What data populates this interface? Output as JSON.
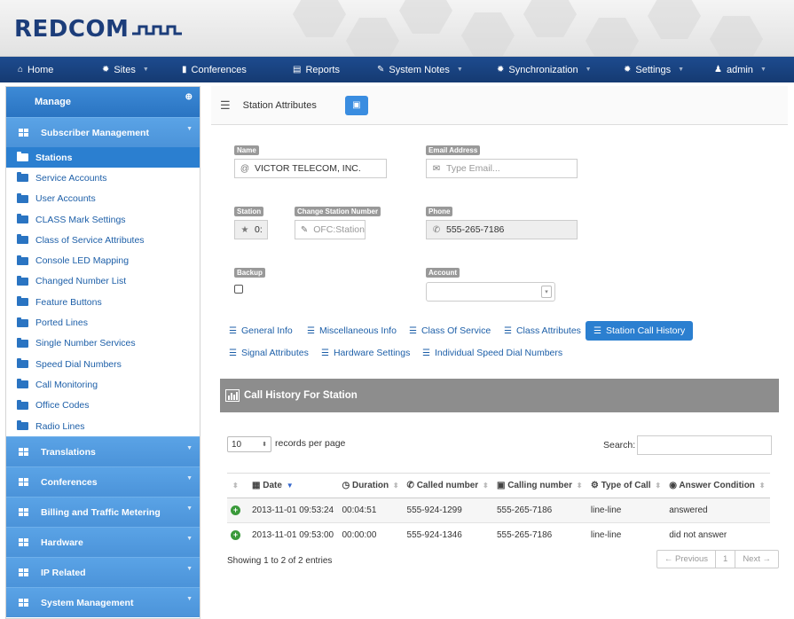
{
  "brand": {
    "logo_text": "REDCOM"
  },
  "nav": {
    "home": "Home",
    "sites": "Sites",
    "conferences": "Conferences",
    "reports": "Reports",
    "system_notes": "System Notes",
    "synchronization": "Synchronization",
    "settings": "Settings",
    "admin": "admin"
  },
  "sidebar": {
    "manage": "Manage",
    "subscriber_management": "Subscriber Management",
    "items": [
      "Stations",
      "Service Accounts",
      "User Accounts",
      "CLASS Mark Settings",
      "Class of Service Attributes",
      "Console LED Mapping",
      "Changed Number List",
      "Feature Buttons",
      "Ported Lines",
      "Single Number Services",
      "Speed Dial Numbers",
      "Call Monitoring",
      "Office Codes",
      "Radio Lines"
    ],
    "sections": [
      "Translations",
      "Conferences",
      "Billing and Traffic Metering",
      "Hardware",
      "IP Related",
      "System Management"
    ]
  },
  "main": {
    "title": "Station Attributes",
    "form": {
      "name_label": "Name",
      "name_value": "VICTOR TELECOM, INC.",
      "email_label": "Email Address",
      "email_placeholder": "Type Email...",
      "station_label": "Station",
      "station_value": "0:",
      "change_station_label": "Change Station Number",
      "change_station_placeholder": "OFC:Station",
      "phone_label": "Phone",
      "phone_value": "555-265-7186",
      "backup_label": "Backup",
      "account_label": "Account"
    },
    "tabs": [
      "General Info",
      "Miscellaneous Info",
      "Class Of Service",
      "Class Attributes",
      "Station Call History",
      "Signal Attributes",
      "Hardware Settings",
      "Individual Speed Dial Numbers"
    ],
    "active_tab": "Station Call History",
    "panel_title": "Call History For Station",
    "records_per_page": "10",
    "records_per_page_label": "records per page",
    "search_label": "Search:",
    "table": {
      "headers": [
        "Date",
        "Duration",
        "Called number",
        "Calling number",
        "Type of Call",
        "Answer Condition"
      ],
      "rows": [
        [
          "2013-11-01 09:53:24",
          "00:04:51",
          "555-924-1299",
          "555-265-7186",
          "line-line",
          "answered"
        ],
        [
          "2013-11-01 09:53:00",
          "00:00:00",
          "555-924-1346",
          "555-265-7186",
          "line-line",
          "did not answer"
        ]
      ]
    },
    "footer_info": "Showing 1 to 2 of 2 entries",
    "pager": {
      "previous": "← Previous",
      "page": "1",
      "next": "Next →"
    }
  },
  "colors": {
    "nav": "#1d4b8f",
    "accent": "#2b7fd0",
    "section": "#4b93d9"
  }
}
